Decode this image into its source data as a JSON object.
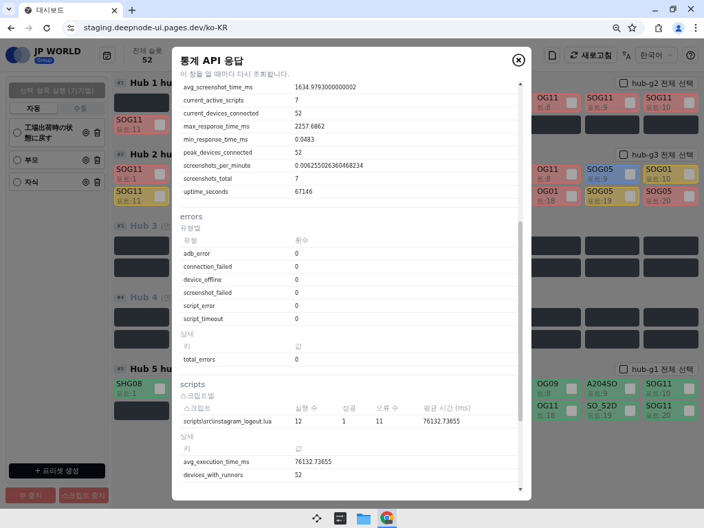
{
  "browser": {
    "tab_title": "대시보드",
    "url": "staging.deepnode-ui.pages.dev/ko-KR"
  },
  "header": {
    "brand": "JP WORLD",
    "brand_badge": "Group",
    "stats": [
      {
        "label": "전체 슬롯",
        "value": "52"
      }
    ],
    "refresh_label": "새로고침",
    "language": "한국어"
  },
  "sidebar": {
    "run_button": "선택 항목 실행 (기기별)",
    "run_disabled": true,
    "modes": [
      {
        "label": "자동",
        "selected": true
      },
      {
        "label": "수동",
        "selected": false
      }
    ],
    "presets": [
      {
        "name": "工場出荷時の状態に戻す",
        "selected": false
      },
      {
        "name": "부모",
        "selected": false
      },
      {
        "name": "자식",
        "selected": false
      }
    ],
    "create_button": "+ 프리셋 생성",
    "stop_buttons": [
      "큐 중지",
      "스크립트 중지"
    ]
  },
  "hubs": [
    {
      "badge": "#1",
      "title": "Hub 1 hu",
      "active": true,
      "select_all": {
        "label": "hub-g2 전체 선택",
        "checked": false
      },
      "rows": [
        {
          "left": {
            "kind": "empty"
          },
          "right": [
            {
              "kind": "device",
              "name": "OG11",
              "port": "트:8",
              "color": "#d06868",
              "checked": false
            },
            {
              "kind": "device",
              "name": "SOG11",
              "port": "포트:9",
              "color": "#d06868",
              "checked": false
            },
            {
              "kind": "device",
              "name": "SOG11",
              "port": "포트:10",
              "color": "#d06868",
              "checked": false
            }
          ]
        },
        {
          "left": {
            "kind": "device",
            "name": "SOG11",
            "port": "포트:11",
            "color": "#d06868",
            "checked": false
          },
          "right": [
            {
              "kind": "empty"
            },
            {
              "kind": "empty"
            },
            {
              "kind": "empty"
            }
          ]
        }
      ]
    },
    {
      "badge": "#2",
      "title": "Hub 2 hu",
      "active": true,
      "select_all": {
        "label": "hub-g3 전체 선택",
        "checked": false
      },
      "rows": [
        {
          "left": {
            "kind": "device",
            "name": "SOG11",
            "port": "포트:1",
            "color": "#d06868",
            "checked": false
          },
          "right": [
            {
              "kind": "device",
              "name": "OG11",
              "port": "트:8",
              "color": "#d06868",
              "checked": false
            },
            {
              "kind": "device",
              "name": "SOG05",
              "port": "포트:9",
              "color": "#5a86cc",
              "checked": false
            },
            {
              "kind": "device",
              "name": "SOG01",
              "port": "포트:10",
              "color": "#c9a63a",
              "checked": false
            }
          ]
        },
        {
          "left": {
            "kind": "device",
            "name": "SOG11",
            "port": "포트:11",
            "color": "#c9a63a",
            "checked": false
          },
          "right": [
            {
              "kind": "device",
              "name": "OG01",
              "port": "트:18",
              "color": "#d06868",
              "checked": false
            },
            {
              "kind": "device",
              "name": "SOG05",
              "port": "포트:19",
              "color": "#c9a63a",
              "checked": false
            },
            {
              "kind": "device",
              "name": "SOG05",
              "port": "포트:20",
              "color": "#d06868",
              "checked": false
            }
          ]
        }
      ]
    },
    {
      "badge": "#3",
      "title": "Hub 3",
      "note": "(연",
      "active": false,
      "rows": [
        {
          "left": {
            "kind": "empty"
          },
          "right": [
            {
              "kind": "empty"
            },
            {
              "kind": "empty"
            },
            {
              "kind": "empty"
            }
          ]
        },
        {
          "left": {
            "kind": "empty"
          },
          "right": [
            {
              "kind": "empty"
            },
            {
              "kind": "empty"
            },
            {
              "kind": "empty"
            }
          ]
        }
      ]
    },
    {
      "badge": "#4",
      "title": "Hub 4",
      "note": "(연",
      "active": false,
      "rows": [
        {
          "left": {
            "kind": "empty"
          },
          "right": [
            {
              "kind": "empty"
            },
            {
              "kind": "empty"
            },
            {
              "kind": "empty"
            }
          ]
        },
        {
          "left": {
            "kind": "empty"
          },
          "right": [
            {
              "kind": "empty"
            },
            {
              "kind": "empty"
            },
            {
              "kind": "empty"
            }
          ]
        }
      ]
    },
    {
      "badge": "#5",
      "title": "Hub 5 hu",
      "active": true,
      "select_all": {
        "label": "hub-g1 전체 선택",
        "checked": false
      },
      "rows": [
        {
          "left": {
            "kind": "device",
            "name": "SHG08",
            "port": "포트:1",
            "color": "#3f9e68",
            "checked": false
          },
          "right": [
            {
              "kind": "device",
              "name": "OG09",
              "port": "트:8",
              "color": "#3f9e68",
              "checked": false
            },
            {
              "kind": "device",
              "name": "A204SO",
              "port": "포트:9",
              "color": "#3f9e68",
              "checked": false
            },
            {
              "kind": "device",
              "name": "SOG11",
              "port": "포트:10",
              "color": "#3f9e68",
              "checked": false
            }
          ]
        },
        {
          "left": {
            "kind": "empty"
          },
          "right": [
            {
              "kind": "device",
              "name": "OG11",
              "port": "트:18",
              "color": "#3f9e68",
              "checked": false
            },
            {
              "kind": "device",
              "name": "SO_52D",
              "port": "포트:19",
              "color": "#3f9e68",
              "checked": false
            },
            {
              "kind": "device",
              "name": "SOG11",
              "port": "포트:20",
              "color": "#3f9e68",
              "checked": false
            }
          ]
        }
      ]
    }
  ],
  "modal": {
    "title": "통계 API 응답",
    "subtitle": "이 창을 열 때마다 다시 조회합니다.",
    "blocks": [
      {
        "kind": "table",
        "rows": [
          [
            "avg_screenshot_time_ms",
            "1634.9793000000002"
          ],
          [
            "current_active_scripts",
            "7"
          ],
          [
            "current_devices_connected",
            "52"
          ],
          [
            "max_response_time_ms",
            "2257.6862"
          ],
          [
            "min_response_time_ms",
            "0.0483"
          ],
          [
            "peak_devices_connected",
            "52"
          ],
          [
            "screenshots_per_minute",
            "0.006255026360468234"
          ],
          [
            "screenshots_total",
            "7"
          ],
          [
            "uptime_seconds",
            "67146"
          ]
        ]
      },
      {
        "kind": "divider"
      },
      {
        "kind": "heading",
        "text": "errors"
      },
      {
        "kind": "caption",
        "text": "유형별"
      },
      {
        "kind": "table",
        "columns": [
          "유형",
          "횟수"
        ],
        "rows": [
          [
            "adb_error",
            "0"
          ],
          [
            "connection_failed",
            "0"
          ],
          [
            "device_offline",
            "0"
          ],
          [
            "screenshot_failed",
            "0"
          ],
          [
            "script_error",
            "0"
          ],
          [
            "script_timeout",
            "0"
          ]
        ]
      },
      {
        "kind": "caption",
        "text": "상세"
      },
      {
        "kind": "table",
        "columns": [
          "키",
          "값"
        ],
        "rows": [
          [
            "total_errors",
            "0"
          ]
        ]
      },
      {
        "kind": "divider"
      },
      {
        "kind": "heading",
        "text": "scripts"
      },
      {
        "kind": "caption",
        "text": "스크립트별"
      },
      {
        "kind": "table",
        "columns": [
          "스크립트",
          "실행 수",
          "성공",
          "오류 수",
          "평균 시간 (ms)"
        ],
        "rows": [
          [
            "scripts\\src\\instagram_logout.lua",
            "12",
            "1",
            "11",
            "76132.73655"
          ]
        ]
      },
      {
        "kind": "caption",
        "text": "상세"
      },
      {
        "kind": "table",
        "columns": [
          "키",
          "값"
        ],
        "rows": [
          [
            "avg_execution_time_ms",
            "76132.73655"
          ],
          [
            "devices_with_runners",
            "52"
          ]
        ]
      }
    ]
  }
}
